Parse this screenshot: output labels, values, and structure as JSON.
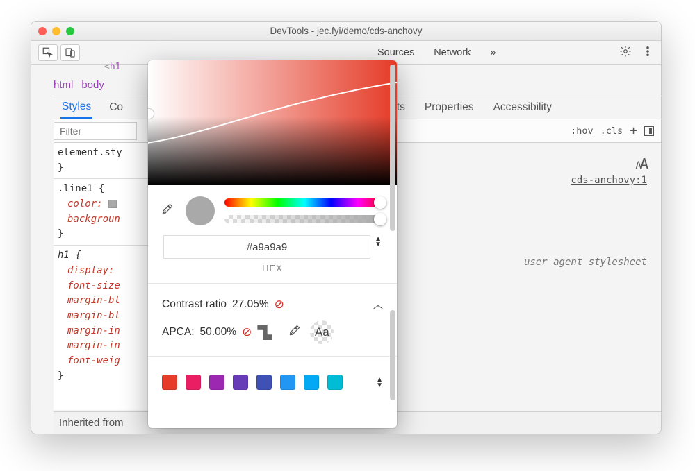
{
  "window": {
    "title": "DevTools - jec.fyi/demo/cds-anchovy"
  },
  "toolbar": {
    "tabs": [
      "Sources",
      "Network"
    ],
    "overflow": "»"
  },
  "html_tag_fragment": "<h1",
  "breadcrumbs": [
    "html",
    "body"
  ],
  "subtabs": {
    "left": [
      "Styles",
      "Co"
    ],
    "right": [
      "Breakpoints",
      "Properties",
      "Accessibility"
    ]
  },
  "filter": {
    "placeholder": "Filter",
    "hov": ":hov",
    "cls": ".cls"
  },
  "styles_pane": {
    "element_style": "element.sty",
    "rule1": {
      "selector": ".line1 {",
      "props": [
        "color:",
        "backgroun"
      ]
    },
    "rule2": {
      "selector": "h1 {",
      "props": [
        "display:",
        "font-size",
        "margin-bl",
        "margin-bl",
        "margin-in",
        "margin-in",
        "font-weig"
      ]
    },
    "inherited": "Inherited from"
  },
  "rightcol": {
    "aa_small": "A",
    "aa_big": "A",
    "source_link": "cds-anchovy:1",
    "uas": "user agent stylesheet"
  },
  "picker": {
    "hex_value": "#a9a9a9",
    "hex_label": "HEX",
    "contrast_label": "Contrast ratio",
    "contrast_value": "27.05%",
    "apca_label": "APCA:",
    "apca_value": "50.00%",
    "aa_sample": "Aa",
    "palette": [
      "#e53b28",
      "#e91e63",
      "#9c27b0",
      "#673ab7",
      "#3f51b5",
      "#2196f3",
      "#03a9f4",
      "#00bcd4"
    ]
  }
}
